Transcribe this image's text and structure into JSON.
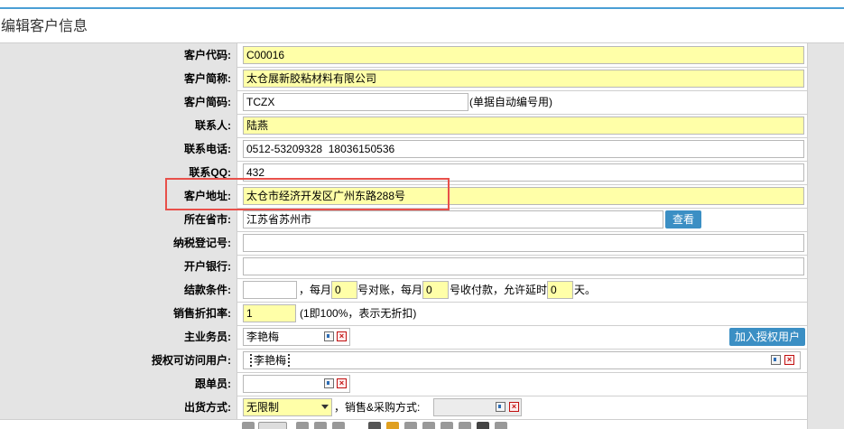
{
  "page": {
    "title": "编辑客户信息"
  },
  "fields": {
    "code": {
      "label": "客户代码:",
      "value": "C00016"
    },
    "short_name": {
      "label": "客户简称:",
      "value": "太仓展新胶粘材料有限公司"
    },
    "abbrev": {
      "label": "客户简码:",
      "value": "TCZX",
      "note": "(单据自动编号用)"
    },
    "contact": {
      "label": "联系人:",
      "value": "陆燕"
    },
    "phone": {
      "label": "联系电话:",
      "value": "0512-53209328  18036150536"
    },
    "qq": {
      "label": "联系QQ:",
      "value": "432"
    },
    "address": {
      "label": "客户地址:",
      "value": "太仓市经济开发区广州东路288号"
    },
    "province_city": {
      "label": "所在省市:",
      "value": "江苏省苏州市",
      "button": "查看"
    },
    "tax_no": {
      "label": "纳税登记号:",
      "value": ""
    },
    "bank": {
      "label": "开户银行:",
      "value": ""
    },
    "payment": {
      "label": "结款条件:",
      "value1": "",
      "text1": "，每月",
      "day1": "0",
      "text2": "号对账，每月",
      "day2": "0",
      "text3": "号收付款，允许延时",
      "delay": "0",
      "text4": "天。"
    },
    "discount": {
      "label": "销售折扣率:",
      "value": "1",
      "note": "(1即100%，表示无折扣)"
    },
    "salesman": {
      "label": "主业务员:",
      "value": "李艳梅",
      "button": "加入授权用户"
    },
    "auth_users": {
      "label": "授权可访问用户:",
      "value": "李艳梅"
    },
    "follower": {
      "label": "跟单员:",
      "value": ""
    },
    "shipping": {
      "label": "出货方式:",
      "select_value": "无限制",
      "text": "，销售&采购方式:",
      "value": ""
    }
  }
}
